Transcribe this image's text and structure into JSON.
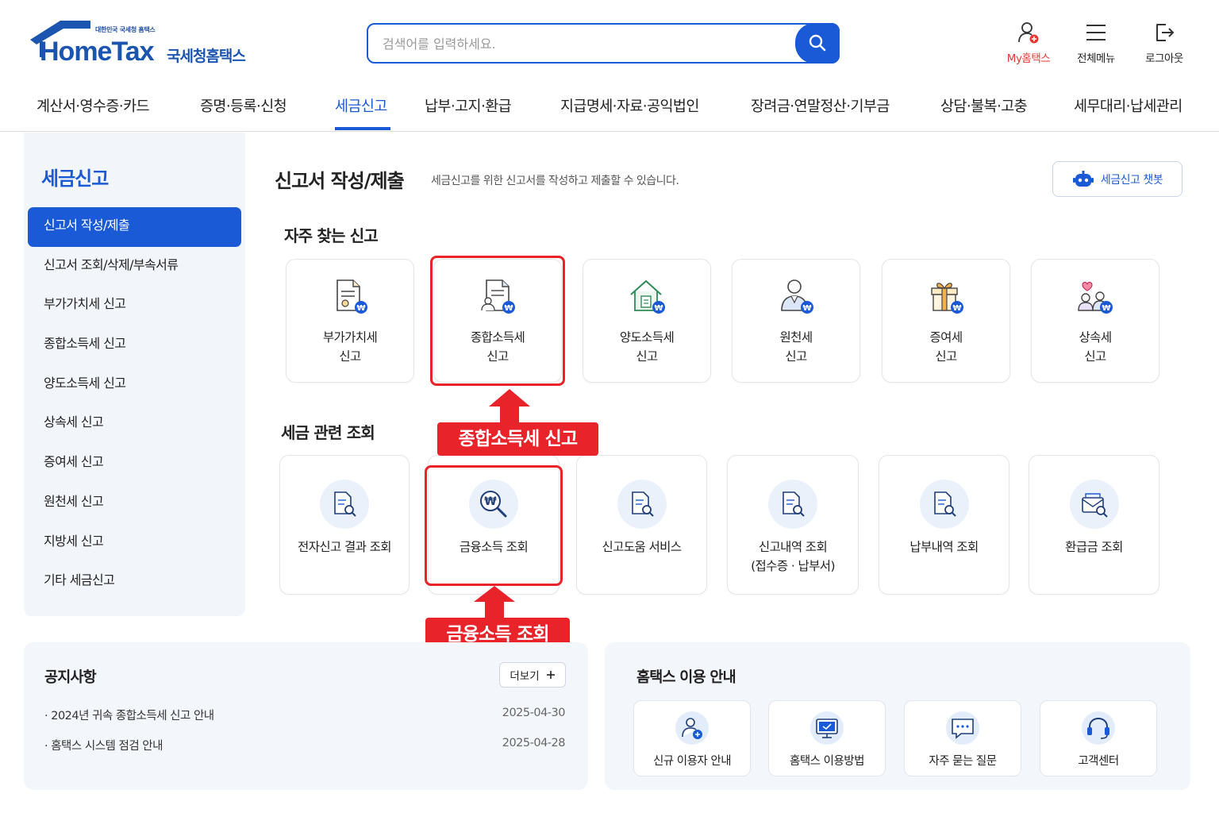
{
  "header": {
    "logo_small": "대한민국 국세청 홈택스",
    "logo_brand": "HomeTax",
    "logo_korean": "국세청홈택스",
    "search_placeholder": "검색어를 입력하세요.",
    "utils": [
      {
        "label": "My홈택스",
        "icon": "user-icon"
      },
      {
        "label": "전체메뉴",
        "icon": "hamburger-menu-icon"
      },
      {
        "label": "로그아웃",
        "icon": "logout-icon"
      }
    ]
  },
  "nav": {
    "items": [
      "계산서·영수증·카드",
      "증명·등록·신청",
      "세금신고",
      "납부·고지·환급",
      "지급명세·자료·공익법인",
      "장려금·연말정산·기부금",
      "상담·불복·고충",
      "세무대리·납세관리"
    ],
    "active": "세금신고"
  },
  "sidebar": {
    "title": "세금신고",
    "items": [
      "신고서 작성/제출",
      "신고서 조회/삭제/부속서류",
      "부가가치세 신고",
      "종합소득세 신고",
      "양도소득세 신고",
      "상속세 신고",
      "증여세 신고",
      "원천세 신고",
      "지방세 신고",
      "기타 세금신고"
    ],
    "active": "신고서 작성/제출"
  },
  "main": {
    "title": "신고서 작성/제출",
    "description": "세금신고를 위한 신고서를 작성하고 제출할 수 있습니다.",
    "chatbot_label": "세금신고 챗봇",
    "frequent_title": "자주 찾는 신고",
    "frequent": [
      {
        "line1": "부가가치세",
        "line2": "신고",
        "icon": "vat-document-icon"
      },
      {
        "line1": "종합소득세",
        "line2": "신고",
        "icon": "income-tax-document-icon"
      },
      {
        "line1": "양도소득세",
        "line2": "신고",
        "icon": "house-transfer-icon"
      },
      {
        "line1": "원천세",
        "line2": "신고",
        "icon": "person-withholding-icon"
      },
      {
        "line1": "증여세",
        "line2": "신고",
        "icon": "gift-icon"
      },
      {
        "line1": "상속세",
        "line2": "신고",
        "icon": "family-inheritance-icon"
      }
    ],
    "lookup_title": "세금 관련 조회",
    "lookup": [
      {
        "line1": "전자신고 결과 조회",
        "line2": "",
        "icon": "document-search-icon"
      },
      {
        "line1": "금융소득 조회",
        "line2": "",
        "icon": "won-magnifier-icon"
      },
      {
        "line1": "신고도움 서비스",
        "line2": "",
        "icon": "document-search-icon"
      },
      {
        "line1": "신고내역 조회",
        "line2": "(접수증 · 납부서)",
        "icon": "document-search-icon"
      },
      {
        "line1": "납부내역 조회",
        "line2": "",
        "icon": "document-search-icon"
      },
      {
        "line1": "환급금 조회",
        "line2": "",
        "icon": "envelope-search-icon"
      }
    ],
    "callouts": {
      "income_tax": "종합소득세 신고",
      "financial_income": "금융소득 조회"
    }
  },
  "notice": {
    "title": "공지사항",
    "more_label": "더보기",
    "items": [
      {
        "text": "2024년 귀속 종합소득세 신고 안내",
        "date": "2025-04-30"
      },
      {
        "text": "홈택스 시스템 점검 안내",
        "date": "2025-04-28"
      }
    ]
  },
  "guide": {
    "title": "홈택스 이용 안내",
    "items": [
      {
        "label": "신규 이용자 안내",
        "icon": "new-user-icon"
      },
      {
        "label": "홈택스 이용방법",
        "icon": "monitor-icon"
      },
      {
        "label": "자주 묻는 질문",
        "icon": "chat-bubble-icon"
      },
      {
        "label": "고객센터",
        "icon": "headset-icon"
      }
    ]
  },
  "colors": {
    "primary": "#1a5ad7",
    "highlight": "#e8232a",
    "sidebar_bg": "#f2f5fa"
  }
}
